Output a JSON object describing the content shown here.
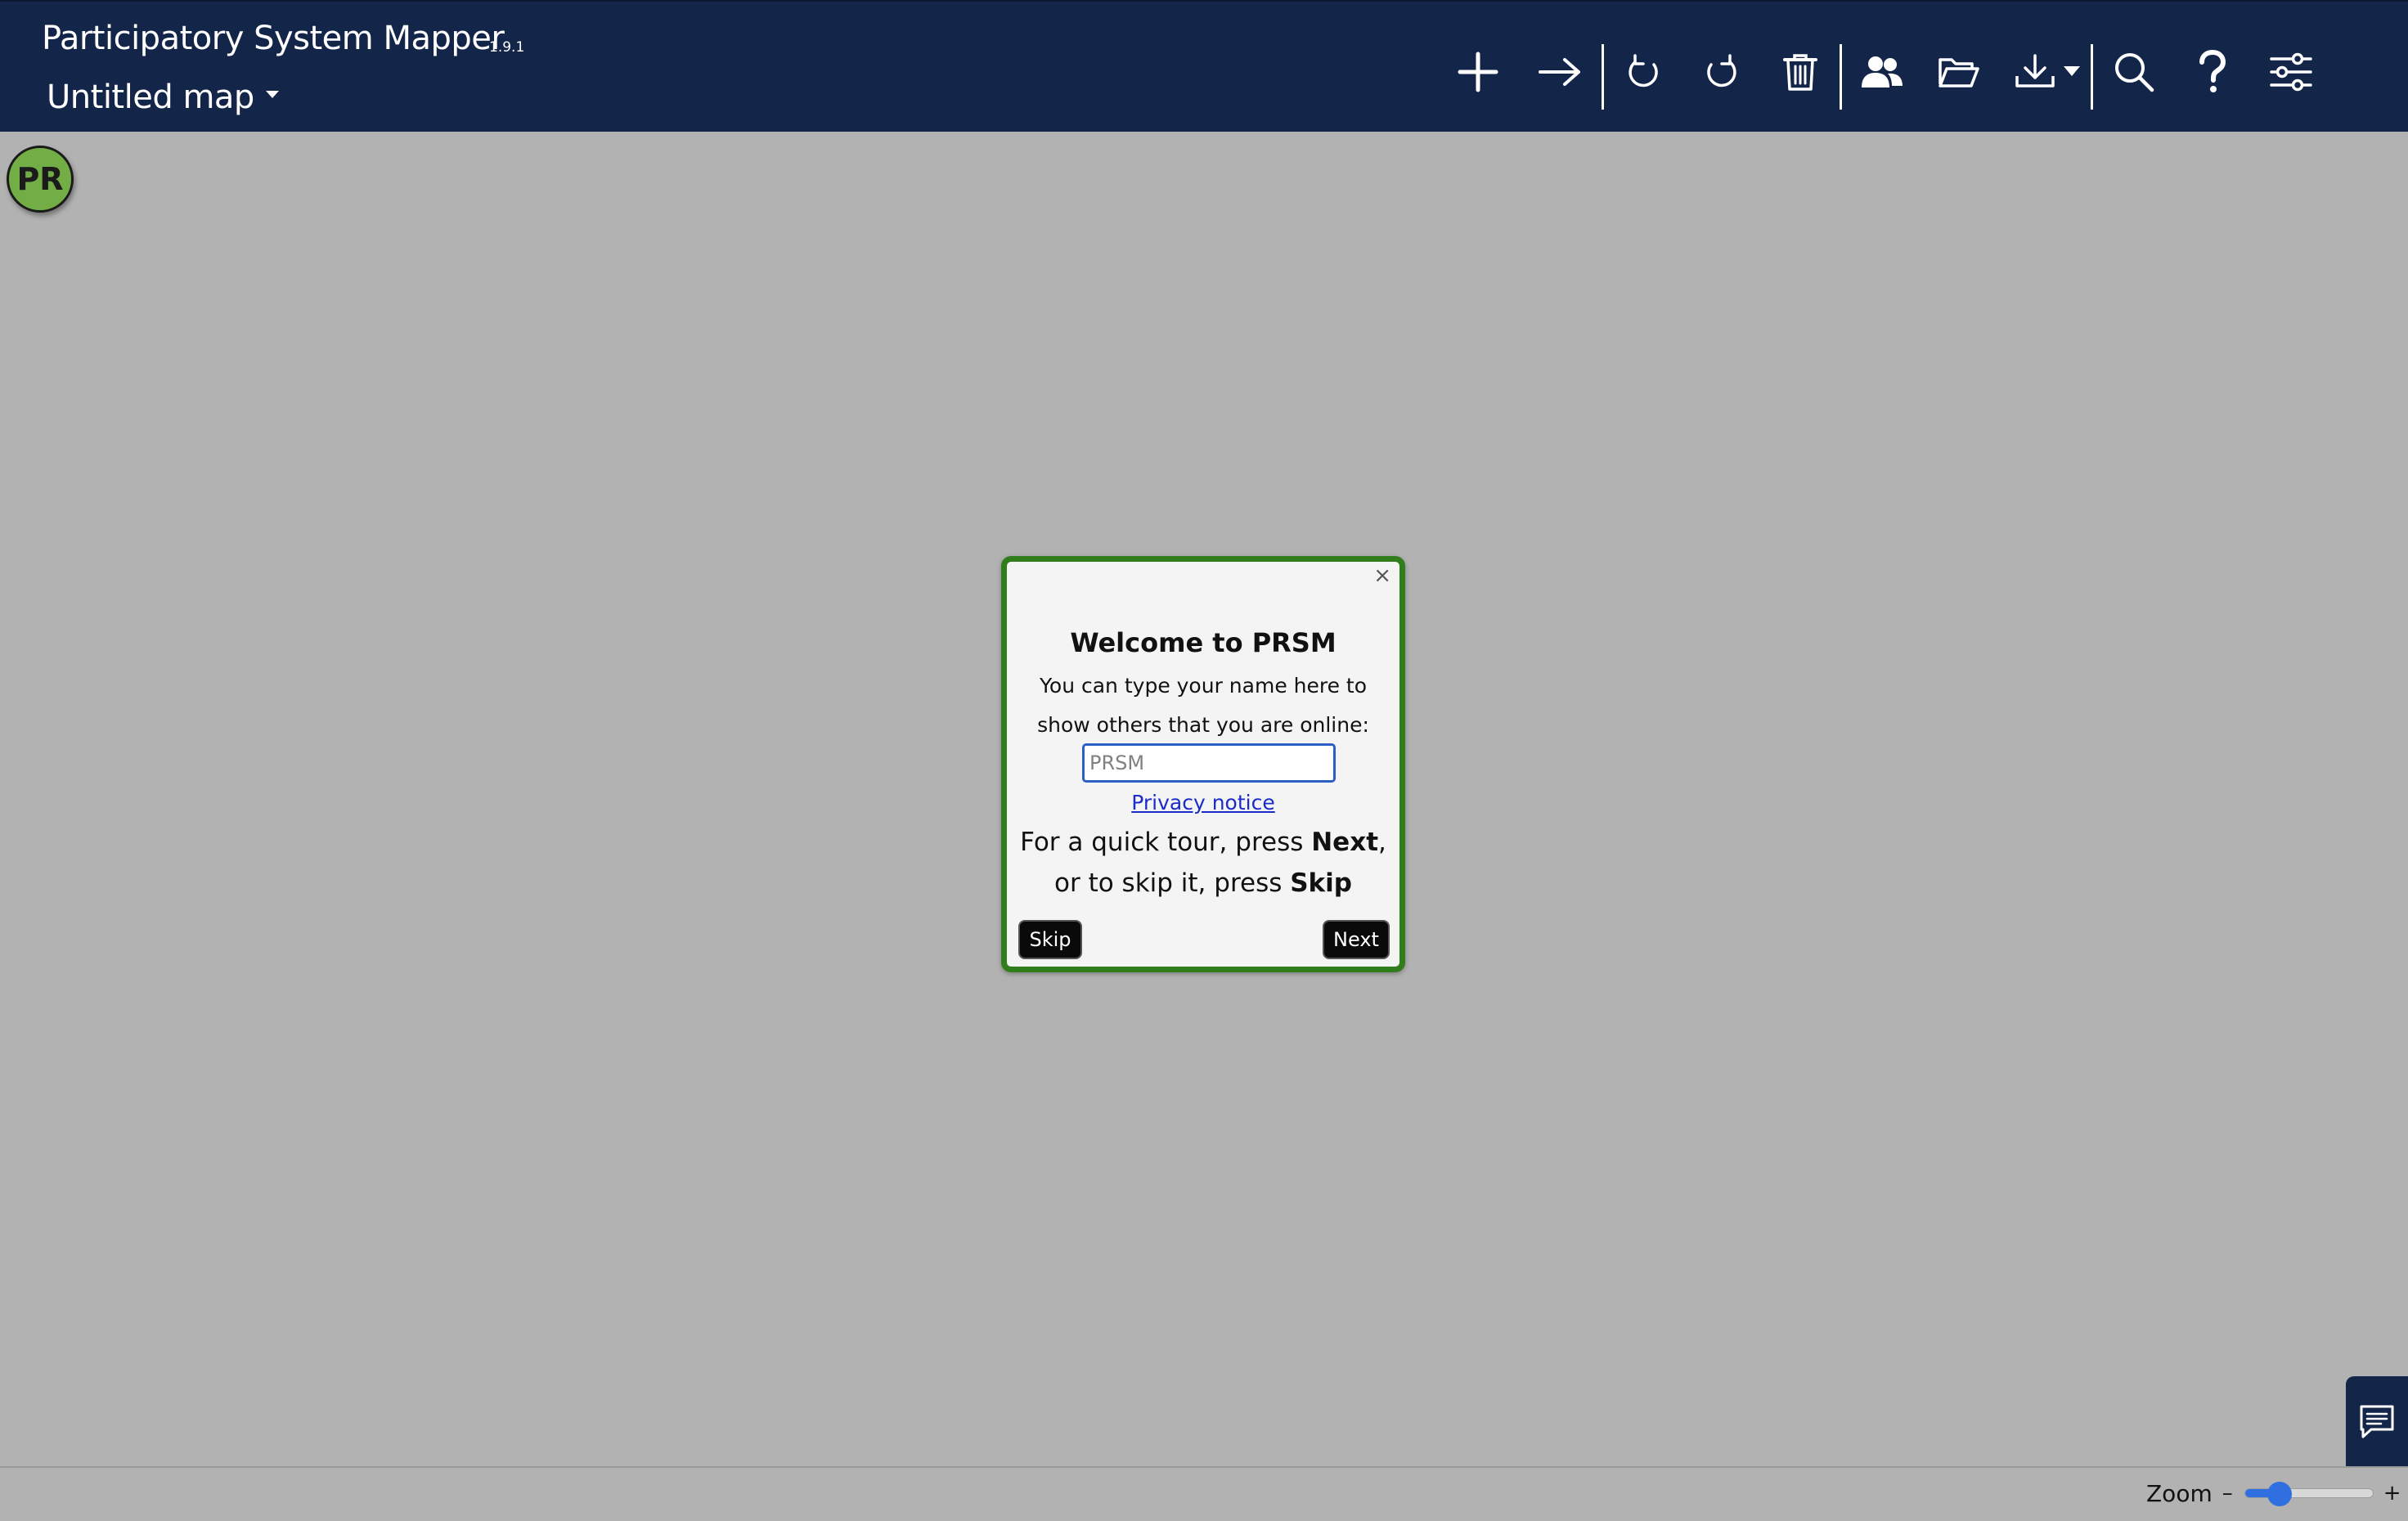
{
  "header": {
    "app_title": "Participatory System Mapper",
    "version": "1.9.1",
    "map_title": "Untitled map"
  },
  "toolbar": {
    "icons": [
      "add-node",
      "add-link",
      "undo",
      "redo",
      "delete",
      "share-users",
      "open-folder",
      "download",
      "search",
      "help",
      "settings-sliders"
    ]
  },
  "avatar": {
    "initials": "PR",
    "color": "#73ad45"
  },
  "dialog": {
    "close": "×",
    "title": "Welcome to PRSM",
    "line1": "You can type your name here to",
    "line2": "show others that you are online:",
    "name_placeholder": "PRSM",
    "privacy_link": "Privacy notice",
    "tour_line1_pre": "For a quick tour, press ",
    "tour_line1_bold": "Next",
    "tour_line1_post": ",",
    "tour_line2_pre": "or to skip it, press ",
    "tour_line2_bold": "Skip",
    "skip_label": "Skip",
    "next_label": "Next"
  },
  "zoom": {
    "label": "Zoom",
    "minus": "–",
    "plus": "+",
    "level": 0.27
  },
  "colors": {
    "header_bg": "#14254a",
    "canvas_bg": "#b2b2b2",
    "dialog_border": "#2f7d1b",
    "accent_blue": "#2f6fe0"
  }
}
